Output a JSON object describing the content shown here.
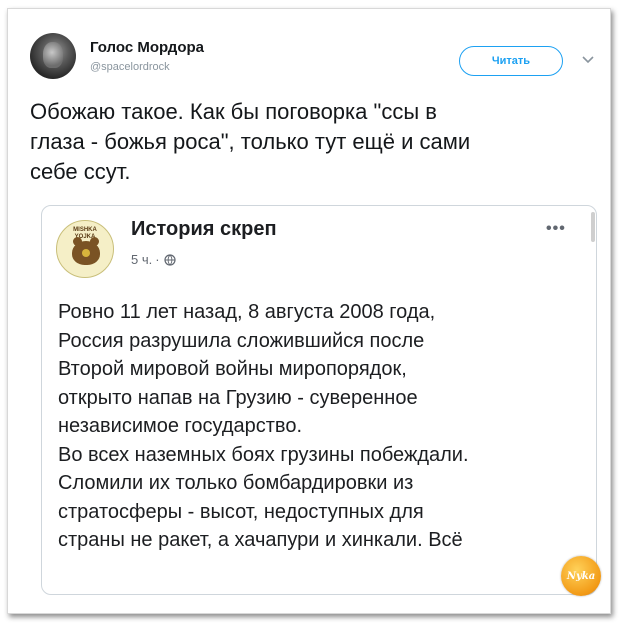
{
  "tweet": {
    "author": {
      "display_name": "Голос Мордора",
      "handle": "@spacelordrock",
      "avatar_icon": "user-avatar-icon"
    },
    "follow_label": "Читать",
    "menu_icon": "chevron-down-icon",
    "text": "Обожаю такое. Как бы поговорка \"ссы в\nглаза - божья роса\", только тут ещё и сами\nсебе ссут."
  },
  "embedded_post": {
    "page_name": "История скреп",
    "logo_text": "MISHKA\nYOJKA",
    "time": "5 ч.",
    "separator": "·",
    "privacy_icon": "globe-icon",
    "more_label": "•••",
    "lines": [
      "Ровно 11 лет назад, 8 августа 2008 года,",
      "Россия разрушила сложившийся после",
      "Второй мировой войны миропорядок,",
      "открыто напав на Грузию - суверенное",
      "независимое государство.",
      "Во всех наземных боях грузины побеждали.",
      "Сломили их только бомбардировки из",
      "стратосферы - высот, недоступных для",
      "страны не ракет, а хачапури и хинкали. Всё"
    ]
  },
  "watermark": {
    "text": "Nyka"
  },
  "colors": {
    "accent": "#1da1f2",
    "text": "#14171a",
    "muted": "#8a959e",
    "card_border": "#cfd6dc",
    "watermark": "#f29a16"
  }
}
